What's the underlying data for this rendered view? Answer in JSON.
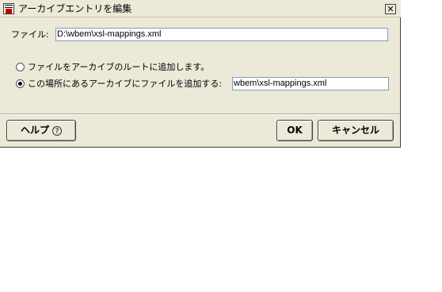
{
  "window": {
    "title": "アーカイブエントリを編集",
    "close_glyph": "✕",
    "app_icon": "app-icon"
  },
  "file": {
    "label": "ファイル:",
    "value": "D:\\wbem\\xsl-mappings.xml"
  },
  "options": {
    "root_label": "ファイルをアーカイブのルートに追加します。",
    "location_label": "この場所にあるアーカイブにファイルを追加する:",
    "location_value": "wbem\\xsl-mappings.xml",
    "selected": "location"
  },
  "buttons": {
    "help_label": "ヘルプ",
    "help_icon_glyph": "?",
    "ok_label": "OK",
    "cancel_label": "キャンセル"
  }
}
